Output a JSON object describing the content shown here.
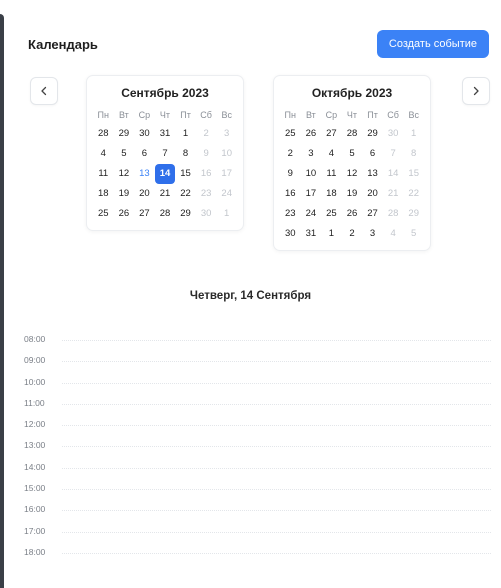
{
  "header": {
    "title": "Календарь",
    "create_button": "Создать событие"
  },
  "nav": {
    "prev_icon": "chevron-left-icon",
    "next_icon": "chevron-right-icon"
  },
  "colors": {
    "accent": "#3b82f6",
    "selected_day": "#2f6fea",
    "muted_day": "#c2c6cc"
  },
  "weekdays": [
    "Пн",
    "Вт",
    "Ср",
    "Чт",
    "Пт",
    "Сб",
    "Вс"
  ],
  "months": [
    {
      "title": "Сентябрь 2023",
      "weeks": [
        [
          "28",
          "29",
          "30",
          "31",
          "1",
          "2",
          "3"
        ],
        [
          "4",
          "5",
          "6",
          "7",
          "8",
          "9",
          "10"
        ],
        [
          "11",
          "12",
          "13",
          "14",
          "15",
          "16",
          "17"
        ],
        [
          "18",
          "19",
          "20",
          "21",
          "22",
          "23",
          "24"
        ],
        [
          "25",
          "26",
          "27",
          "28",
          "29",
          "30",
          "1"
        ]
      ],
      "today": "13",
      "selected": "14"
    },
    {
      "title": "Октябрь 2023",
      "weeks": [
        [
          "25",
          "26",
          "27",
          "28",
          "29",
          "30",
          "1"
        ],
        [
          "2",
          "3",
          "4",
          "5",
          "6",
          "7",
          "8"
        ],
        [
          "9",
          "10",
          "11",
          "12",
          "13",
          "14",
          "15"
        ],
        [
          "16",
          "17",
          "18",
          "19",
          "20",
          "21",
          "22"
        ],
        [
          "23",
          "24",
          "25",
          "26",
          "27",
          "28",
          "29"
        ],
        [
          "30",
          "31",
          "1",
          "2",
          "3",
          "4",
          "5"
        ]
      ]
    }
  ],
  "day_view": {
    "heading": "Четверг, 14 Сентября",
    "times": [
      "08:00",
      "09:00",
      "10:00",
      "11:00",
      "12:00",
      "13:00",
      "14:00",
      "15:00",
      "16:00",
      "17:00",
      "18:00"
    ]
  }
}
